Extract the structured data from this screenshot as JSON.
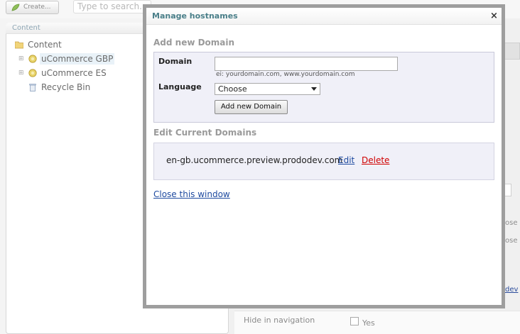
{
  "toolbar": {
    "create_label": "Create...",
    "search_placeholder": "Type to search..."
  },
  "tree": {
    "section_label": "Content",
    "items": [
      {
        "label": "Content",
        "icon": "folder-icon"
      },
      {
        "label": "uCommerce GBP",
        "icon": "globe-icon",
        "selected": true
      },
      {
        "label": "uCommerce ES",
        "icon": "globe-icon"
      },
      {
        "label": "Recycle Bin",
        "icon": "recycle-bin-icon"
      }
    ]
  },
  "background_form": {
    "hide_in_navigation_label": "Hide in navigation",
    "hide_in_navigation_value": "Yes",
    "fragment_1": "ose",
    "fragment_2": "ose",
    "fragment_3": "dev"
  },
  "modal": {
    "title": "Manage hostnames",
    "close_glyph": "×",
    "add_section_heading": "Add new Domain",
    "domain_label": "Domain",
    "domain_value": "",
    "domain_hint": "ei: yourdomain.com, www.yourdomain.com",
    "language_label": "Language",
    "language_selected": "Choose",
    "add_button_label": "Add new Domain",
    "edit_section_heading": "Edit Current Domains",
    "domains": [
      {
        "hostname": "en-gb.ucommerce.preview.prododev.com",
        "edit_label": "Edit",
        "delete_label": "Delete"
      }
    ],
    "close_window_label": "Close this window"
  },
  "colors": {
    "title_color": "#4a7f89",
    "link_color": "#1f4ba0",
    "delete_color": "#d00000",
    "panel_bg": "#f0f0f8"
  }
}
